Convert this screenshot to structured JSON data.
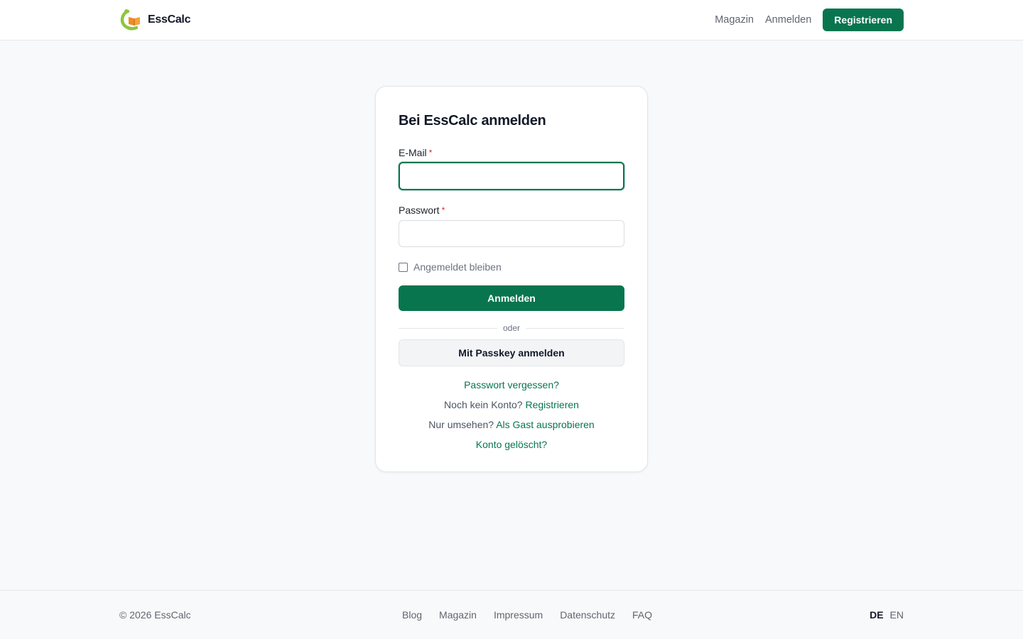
{
  "header": {
    "brand": "EssCalc",
    "nav": {
      "magazin": "Magazin",
      "login": "Anmelden",
      "register": "Registrieren"
    }
  },
  "login_card": {
    "title": "Bei EssCalc anmelden",
    "email_label": "E-Mail",
    "email_value": "",
    "password_label": "Passwort",
    "password_value": "",
    "required_marker": "*",
    "remember_label": "Angemeldet bleiben",
    "remember_checked": false,
    "submit_label": "Anmelden",
    "divider_text": "oder",
    "passkey_label": "Mit Passkey anmelden",
    "forgot_password": "Passwort vergessen?",
    "no_account_prefix": "Noch kein Konto?",
    "no_account_link": "Registrieren",
    "browse_prefix": "Nur umsehen?",
    "browse_link": "Als Gast ausprobieren",
    "account_deleted": "Konto gelöscht?"
  },
  "footer": {
    "copyright": "© 2026 EssCalc",
    "links": [
      "Blog",
      "Magazin",
      "Impressum",
      "Datenschutz",
      "FAQ"
    ],
    "languages": {
      "active": "DE",
      "other": "EN"
    }
  },
  "colors": {
    "accent": "#08754f",
    "logo_green": "#8cc63f",
    "logo_orange": "#f08a24",
    "required": "#dc2626"
  },
  "icons": {
    "logo": "essCalc-logo-icon"
  }
}
